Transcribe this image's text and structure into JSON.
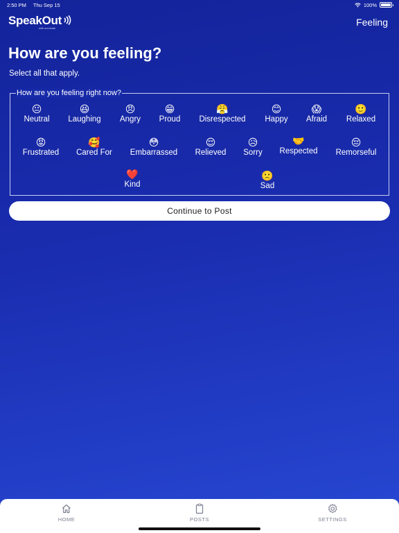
{
  "status": {
    "time": "2:50 PM",
    "date": "Thu Sep 15",
    "battery": "100%"
  },
  "header": {
    "logo": "SpeakOut",
    "logo_sub": "with survicate",
    "title": "Feeling"
  },
  "main": {
    "title": "How are you feeling?",
    "subtitle": "Select all that apply.",
    "legend": "How are you feeling right now?",
    "feelings": [
      {
        "emoji": "😐",
        "label": "Neutral"
      },
      {
        "emoji": "😆",
        "label": "Laughing"
      },
      {
        "emoji": "😠",
        "label": "Angry"
      },
      {
        "emoji": "😁",
        "label": "Proud"
      },
      {
        "emoji": "😤",
        "label": "Disrespected"
      },
      {
        "emoji": "😊",
        "label": "Happy"
      },
      {
        "emoji": "😱",
        "label": "Afraid"
      },
      {
        "emoji": "🙂",
        "label": "Relaxed"
      },
      {
        "emoji": "😡",
        "label": "Frustrated"
      },
      {
        "emoji": "🥰",
        "label": "Cared For"
      },
      {
        "emoji": "😳",
        "label": "Embarrassed"
      },
      {
        "emoji": "😌",
        "label": "Relieved"
      },
      {
        "emoji": "😥",
        "label": "Sorry"
      },
      {
        "emoji": "🤝",
        "label": "Respected"
      },
      {
        "emoji": "😔",
        "label": "Remorseful"
      },
      {
        "emoji": "❤️",
        "label": "Kind"
      },
      {
        "emoji": "🙁",
        "label": "Sad"
      }
    ],
    "continue_label": "Continue to Post"
  },
  "tabs": [
    {
      "label": "HOME",
      "icon": "home-icon"
    },
    {
      "label": "POSTS",
      "icon": "clipboard-icon"
    },
    {
      "label": "SETTINGS",
      "icon": "gear-icon"
    }
  ]
}
